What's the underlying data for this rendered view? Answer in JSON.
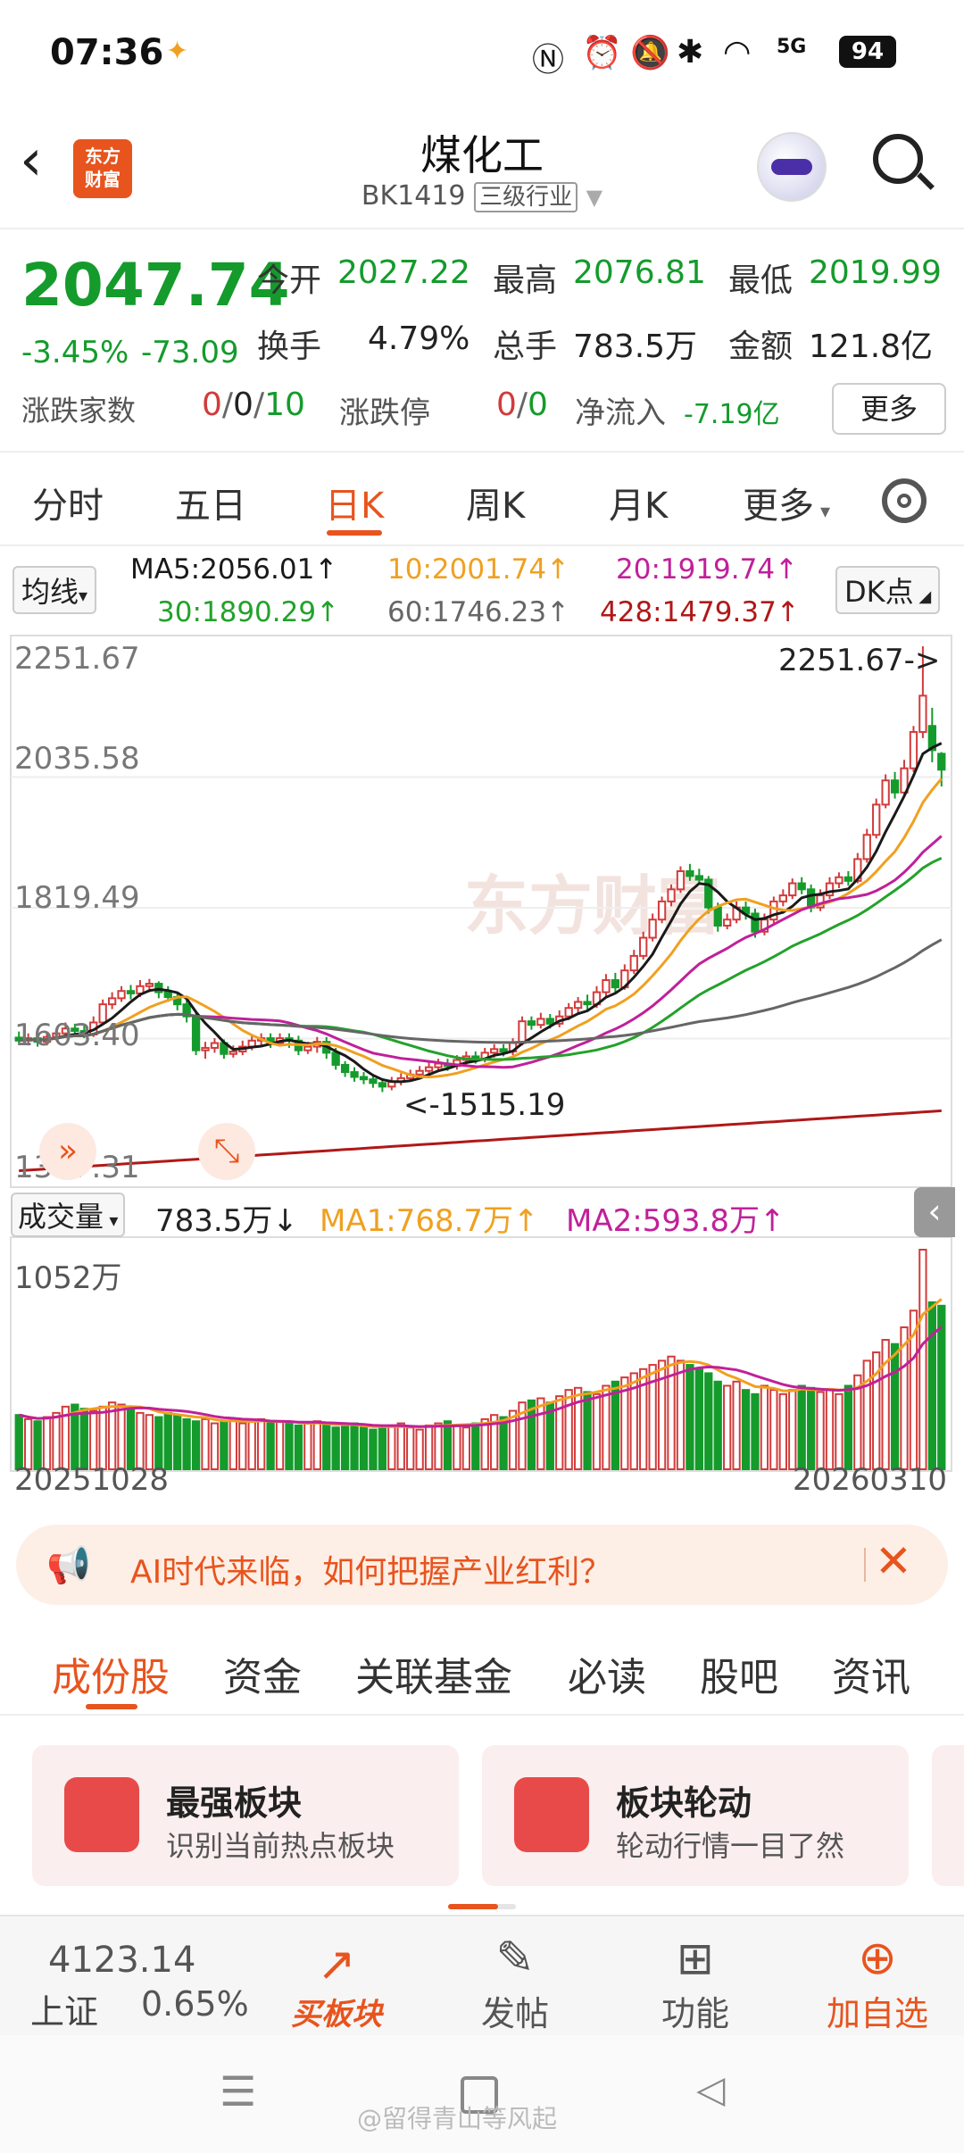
{
  "status": {
    "time": "07:36",
    "battery": "94",
    "signal_label": "5G"
  },
  "header": {
    "title": "煤化工",
    "code": "BK1419",
    "tag": "三级行业",
    "logo_line1": "东方",
    "logo_line2": "财富"
  },
  "quote": {
    "price": "2047.74",
    "change_pct": "-3.45%",
    "change": "-73.09",
    "open_label": "今开",
    "open": "2027.22",
    "high_label": "最高",
    "high": "2076.81",
    "low_label": "最低",
    "low": "2019.99",
    "turnover_label": "换手",
    "turnover": "4.79%",
    "volume_label": "总手",
    "volume": "783.5万",
    "amount_label": "金额",
    "amount": "121.8亿",
    "breadth_label": "涨跌家数",
    "breadth_up": "0",
    "breadth_flat": "0",
    "breadth_down": "10",
    "limit_label": "涨跌停",
    "limit_up": "0",
    "limit_down": "0",
    "netflow_label": "净流入",
    "netflow": "-7.19亿",
    "more": "更多"
  },
  "ktabs": [
    "分时",
    "五日",
    "日K",
    "周K",
    "月K",
    "更多"
  ],
  "ma_row": {
    "dropdown": "均线",
    "ma5": "MA5:2056.01↑",
    "ma10": "10:2001.74↑",
    "ma20": "20:1919.74↑",
    "ma30": "30:1890.29↑",
    "ma60": "60:1746.23↑",
    "ma428": "428:1479.37↑",
    "dk": "DK点"
  },
  "chart_data": {
    "type": "candlestick",
    "y_ticks": [
      "2251.67",
      "2035.58",
      "1819.49",
      "1603.40",
      "1387.31"
    ],
    "ylim": [
      1387.31,
      2251.67
    ],
    "max_label": "2251.67->",
    "min_label": "<-1515.19",
    "watermark": "东方财富",
    "x_start": "20251028",
    "x_end": "20260310",
    "candles": [
      [
        1605,
        1600,
        1615,
        1595
      ],
      [
        1600,
        1604,
        1612,
        1592
      ],
      [
        1604,
        1598,
        1610,
        1590
      ],
      [
        1598,
        1606,
        1614,
        1592
      ],
      [
        1606,
        1612,
        1620,
        1600
      ],
      [
        1612,
        1620,
        1630,
        1606
      ],
      [
        1620,
        1616,
        1628,
        1608
      ],
      [
        1616,
        1610,
        1624,
        1604
      ],
      [
        1610,
        1630,
        1640,
        1606
      ],
      [
        1630,
        1660,
        1668,
        1626
      ],
      [
        1660,
        1670,
        1680,
        1652
      ],
      [
        1670,
        1682,
        1690,
        1664
      ],
      [
        1682,
        1678,
        1692,
        1668
      ],
      [
        1678,
        1690,
        1700,
        1672
      ],
      [
        1690,
        1694,
        1702,
        1680
      ],
      [
        1694,
        1680,
        1698,
        1670
      ],
      [
        1680,
        1672,
        1690,
        1664
      ],
      [
        1672,
        1660,
        1680,
        1650
      ],
      [
        1660,
        1640,
        1668,
        1630
      ],
      [
        1640,
        1584,
        1648,
        1576
      ],
      [
        1584,
        1588,
        1598,
        1570
      ],
      [
        1588,
        1596,
        1604,
        1580
      ],
      [
        1596,
        1578,
        1602,
        1570
      ],
      [
        1578,
        1582,
        1592,
        1572
      ],
      [
        1582,
        1590,
        1600,
        1576
      ],
      [
        1590,
        1600,
        1608,
        1584
      ],
      [
        1600,
        1604,
        1612,
        1592
      ],
      [
        1604,
        1596,
        1612,
        1588
      ],
      [
        1596,
        1604,
        1612,
        1590
      ],
      [
        1604,
        1600,
        1612,
        1588
      ],
      [
        1600,
        1584,
        1608,
        1576
      ],
      [
        1584,
        1590,
        1598,
        1578
      ],
      [
        1590,
        1598,
        1606,
        1580
      ],
      [
        1598,
        1580,
        1606,
        1570
      ],
      [
        1580,
        1560,
        1588,
        1552
      ],
      [
        1560,
        1548,
        1566,
        1540
      ],
      [
        1548,
        1540,
        1556,
        1532
      ],
      [
        1540,
        1536,
        1548,
        1528
      ],
      [
        1536,
        1530,
        1544,
        1522
      ],
      [
        1530,
        1524,
        1538,
        1515
      ],
      [
        1524,
        1532,
        1540,
        1518
      ],
      [
        1532,
        1538,
        1546,
        1526
      ],
      [
        1538,
        1544,
        1552,
        1532
      ],
      [
        1544,
        1550,
        1558,
        1538
      ],
      [
        1550,
        1556,
        1564,
        1544
      ],
      [
        1556,
        1562,
        1570,
        1548
      ],
      [
        1562,
        1558,
        1570,
        1550
      ],
      [
        1558,
        1568,
        1576,
        1552
      ],
      [
        1568,
        1574,
        1582,
        1560
      ],
      [
        1574,
        1570,
        1582,
        1562
      ],
      [
        1570,
        1580,
        1588,
        1564
      ],
      [
        1580,
        1586,
        1594,
        1572
      ],
      [
        1586,
        1582,
        1594,
        1574
      ],
      [
        1582,
        1596,
        1604,
        1576
      ],
      [
        1596,
        1632,
        1640,
        1592
      ],
      [
        1632,
        1626,
        1640,
        1618
      ],
      [
        1626,
        1636,
        1646,
        1620
      ],
      [
        1636,
        1628,
        1644,
        1620
      ],
      [
        1628,
        1640,
        1650,
        1622
      ],
      [
        1640,
        1654,
        1662,
        1634
      ],
      [
        1654,
        1664,
        1672,
        1646
      ],
      [
        1664,
        1660,
        1676,
        1650
      ],
      [
        1660,
        1680,
        1690,
        1654
      ],
      [
        1680,
        1700,
        1710,
        1672
      ],
      [
        1700,
        1688,
        1712,
        1680
      ],
      [
        1688,
        1716,
        1726,
        1684
      ],
      [
        1716,
        1740,
        1750,
        1710
      ],
      [
        1740,
        1770,
        1780,
        1734
      ],
      [
        1770,
        1800,
        1810,
        1764
      ],
      [
        1800,
        1830,
        1838,
        1794
      ],
      [
        1830,
        1850,
        1858,
        1822
      ],
      [
        1850,
        1880,
        1888,
        1844
      ],
      [
        1880,
        1872,
        1892,
        1864
      ],
      [
        1872,
        1866,
        1884,
        1858
      ],
      [
        1866,
        1820,
        1872,
        1810
      ],
      [
        1820,
        1790,
        1828,
        1780
      ],
      [
        1790,
        1800,
        1810,
        1784
      ],
      [
        1800,
        1820,
        1830,
        1794
      ],
      [
        1820,
        1810,
        1830,
        1800
      ],
      [
        1810,
        1780,
        1818,
        1770
      ],
      [
        1780,
        1800,
        1810,
        1774
      ],
      [
        1800,
        1830,
        1838,
        1794
      ],
      [
        1830,
        1840,
        1850,
        1822
      ],
      [
        1840,
        1860,
        1868,
        1834
      ],
      [
        1860,
        1850,
        1870,
        1842
      ],
      [
        1850,
        1820,
        1858,
        1812
      ],
      [
        1820,
        1840,
        1850,
        1814
      ],
      [
        1840,
        1860,
        1870,
        1834
      ],
      [
        1860,
        1870,
        1878,
        1852
      ],
      [
        1870,
        1864,
        1880,
        1856
      ],
      [
        1864,
        1900,
        1910,
        1860
      ],
      [
        1900,
        1940,
        1950,
        1894
      ],
      [
        1940,
        1990,
        2000,
        1934
      ],
      [
        1990,
        2030,
        2040,
        1984
      ],
      [
        2030,
        2010,
        2044,
        2000
      ],
      [
        2010,
        2050,
        2064,
        2004
      ],
      [
        2050,
        2110,
        2120,
        2044
      ],
      [
        2110,
        2170,
        2251.67,
        2100
      ],
      [
        2120,
        2080,
        2150,
        2060
      ],
      [
        2074,
        2047.74,
        2076.81,
        2019.99
      ]
    ],
    "ma_colors": {
      "ma5": "#1a1a1a",
      "ma10": "#f0a020",
      "ma20": "#c0209a",
      "ma30": "#22a22a",
      "ma60": "#666666",
      "ma428": "#b01818"
    }
  },
  "volume": {
    "dropdown": "成交量",
    "value": "783.5万↓",
    "ma1": "MA1:768.7万↑",
    "ma2": "MA2:593.8万↑",
    "tick": "1052万",
    "bars": [
      260,
      240,
      230,
      250,
      270,
      300,
      310,
      290,
      280,
      300,
      320,
      310,
      290,
      270,
      260,
      250,
      270,
      260,
      240,
      230,
      240,
      220,
      230,
      240,
      220,
      230,
      240,
      220,
      230,
      220,
      210,
      220,
      230,
      210,
      200,
      210,
      220,
      200,
      190,
      200,
      210,
      220,
      200,
      190,
      210,
      220,
      230,
      210,
      200,
      220,
      240,
      260,
      250,
      280,
      320,
      330,
      340,
      320,
      350,
      380,
      390,
      370,
      360,
      400,
      420,
      440,
      460,
      480,
      500,
      520,
      540,
      520,
      500,
      480,
      460,
      420,
      400,
      420,
      380,
      360,
      400,
      380,
      360,
      380,
      400,
      390,
      370,
      380,
      360,
      400,
      450,
      520,
      560,
      620,
      600,
      680,
      760,
      1052,
      800,
      783.5
    ],
    "bar_up": [
      0,
      1,
      0,
      1,
      1,
      1,
      0,
      0,
      1,
      1,
      1,
      1,
      0,
      1,
      1,
      0,
      0,
      0,
      0,
      0,
      1,
      1,
      0,
      1,
      1,
      1,
      1,
      0,
      1,
      0,
      0,
      1,
      1,
      0,
      0,
      0,
      0,
      0,
      0,
      0,
      1,
      1,
      1,
      1,
      1,
      1,
      0,
      1,
      1,
      0,
      1,
      1,
      0,
      1,
      1,
      0,
      1,
      0,
      1,
      1,
      1,
      0,
      1,
      1,
      0,
      1,
      1,
      1,
      1,
      1,
      1,
      1,
      0,
      0,
      0,
      0,
      1,
      1,
      0,
      0,
      1,
      1,
      1,
      1,
      0,
      0,
      1,
      1,
      1,
      0,
      1,
      1,
      1,
      1,
      0,
      1,
      1,
      1,
      0,
      0
    ]
  },
  "ai_banner": {
    "text": "AI时代来临，如何把握产业红利？"
  },
  "bottom_tabs": [
    "成份股",
    "资金",
    "关联基金",
    "必读",
    "股吧",
    "资讯"
  ],
  "cards": [
    {
      "title": "最强板块",
      "subtitle": "识别当前热点板块"
    },
    {
      "title": "板块轮动",
      "subtitle": "轮动行情一目了然"
    }
  ],
  "bottom_bar": {
    "index_value": "4123.14",
    "index_name": "上证",
    "index_change": "0.65%",
    "buy": "买板块",
    "post": "发帖",
    "func": "功能",
    "add": "加自选"
  },
  "watermark_footer": "@留得青山等风起"
}
